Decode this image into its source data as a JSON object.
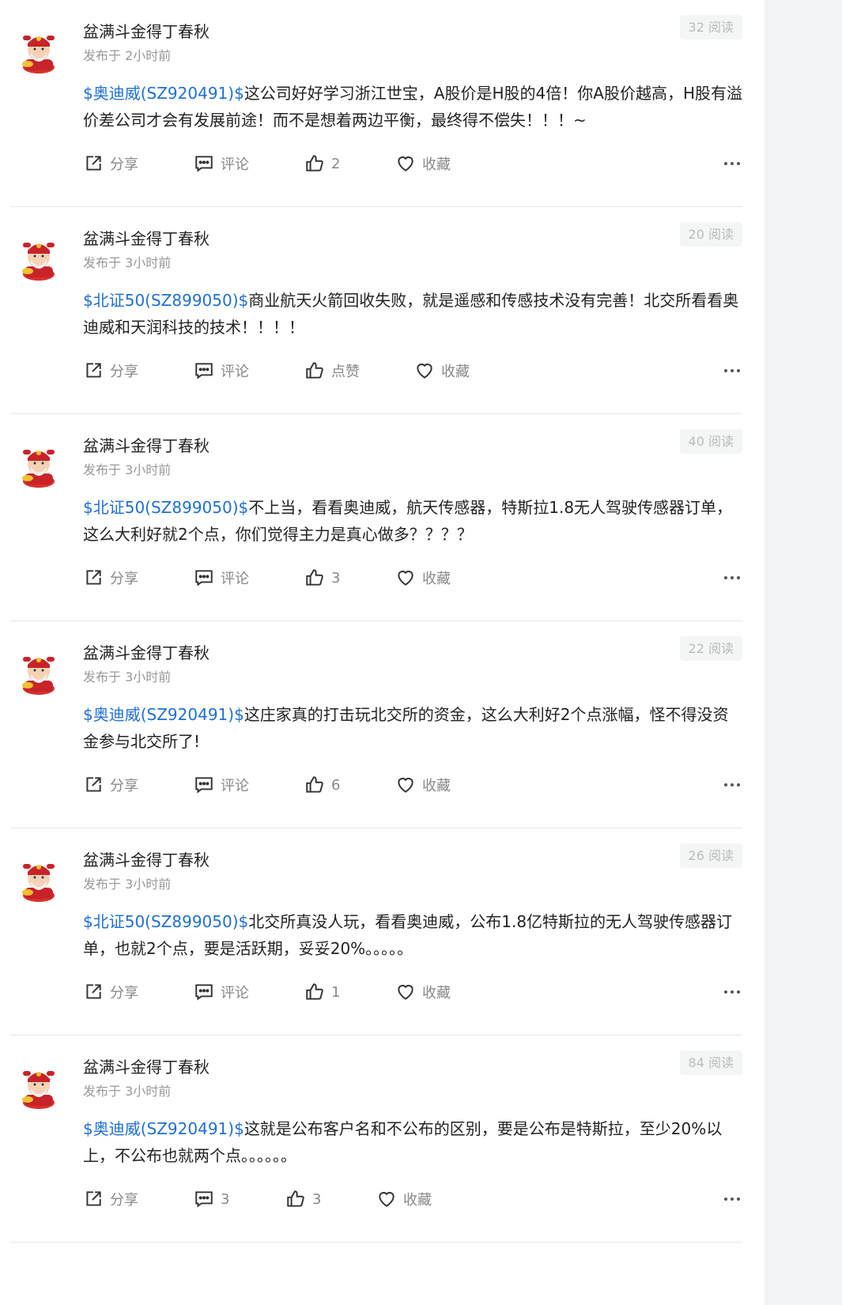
{
  "posts": [
    {
      "author": "盆满斗金得丁春秋",
      "time": "发布于 2小时前",
      "reads": "32 阅读",
      "stock": "$奥迪威(SZ920491)$",
      "text": "这公司好好学习浙江世宝，A股价是H股的4倍！你A股价越高，H股有溢价差公司才会有发展前途！而不是想着两边平衡，最终得不偿失！！！~",
      "share": "分享",
      "comment": "评论",
      "like": "2",
      "fav": "收藏"
    },
    {
      "author": "盆满斗金得丁春秋",
      "time": "发布于 3小时前",
      "reads": "20 阅读",
      "stock": "$北证50(SZ899050)$",
      "text": "商业航天火箭回收失败，就是遥感和传感技术没有完善！北交所看看奥迪威和天润科技的技术！！！！",
      "share": "分享",
      "comment": "评论",
      "like": "点赞",
      "fav": "收藏"
    },
    {
      "author": "盆满斗金得丁春秋",
      "time": "发布于 3小时前",
      "reads": "40 阅读",
      "stock": "$北证50(SZ899050)$",
      "text": "不上当，看看奥迪威，航天传感器，特斯拉1.8无人驾驶传感器订单，这么大利好就2个点，你们觉得主力是真心做多？？？？",
      "share": "分享",
      "comment": "评论",
      "like": "3",
      "fav": "收藏"
    },
    {
      "author": "盆满斗金得丁春秋",
      "time": "发布于 3小时前",
      "reads": "22 阅读",
      "stock": "$奥迪威(SZ920491)$",
      "text": "这庄家真的打击玩北交所的资金，这么大利好2个点涨幅，怪不得没资金参与北交所了!",
      "share": "分享",
      "comment": "评论",
      "like": "6",
      "fav": "收藏"
    },
    {
      "author": "盆满斗金得丁春秋",
      "time": "发布于 3小时前",
      "reads": "26 阅读",
      "stock": "$北证50(SZ899050)$",
      "text": "北交所真没人玩，看看奥迪威，公布1.8亿特斯拉的无人驾驶传感器订单，也就2个点，要是活跃期，妥妥20%。。。。。",
      "share": "分享",
      "comment": "评论",
      "like": "1",
      "fav": "收藏"
    },
    {
      "author": "盆满斗金得丁春秋",
      "time": "发布于 3小时前",
      "reads": "84 阅读",
      "stock": "$奥迪威(SZ920491)$",
      "text": "这就是公布客户名和不公布的区别，要是公布是特斯拉，至少20%以上，不公布也就两个点。。。。。。",
      "share": "分享",
      "comment": "3",
      "like": "3",
      "fav": "收藏"
    }
  ]
}
